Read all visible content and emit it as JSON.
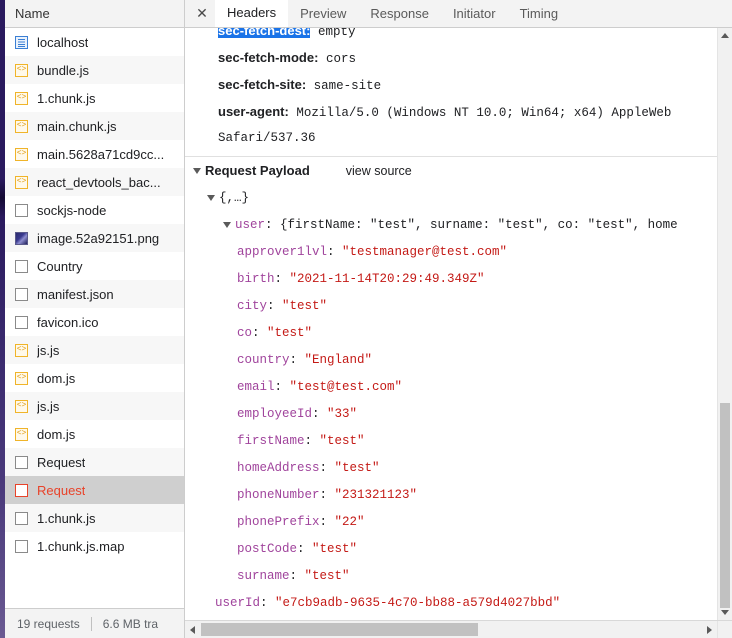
{
  "sidebar": {
    "header": "Name",
    "files": [
      {
        "name": "localhost",
        "icon": "document-icon",
        "kind": "doc",
        "selected": false
      },
      {
        "name": "bundle.js",
        "icon": "js-file-icon",
        "kind": "js",
        "selected": false
      },
      {
        "name": "1.chunk.js",
        "icon": "js-file-icon",
        "kind": "js",
        "selected": false
      },
      {
        "name": "main.chunk.js",
        "icon": "js-file-icon",
        "kind": "js",
        "selected": false
      },
      {
        "name": "main.5628a71cd9cc...",
        "icon": "js-file-icon",
        "kind": "js",
        "selected": false
      },
      {
        "name": "react_devtools_bac...",
        "icon": "js-file-icon",
        "kind": "js",
        "selected": false
      },
      {
        "name": "sockjs-node",
        "icon": "generic-file-icon",
        "kind": "plain",
        "selected": false
      },
      {
        "name": "image.52a92151.png",
        "icon": "image-file-icon",
        "kind": "img",
        "selected": false
      },
      {
        "name": "Country",
        "icon": "generic-file-icon",
        "kind": "plain",
        "selected": false
      },
      {
        "name": "manifest.json",
        "icon": "generic-file-icon",
        "kind": "plain",
        "selected": false
      },
      {
        "name": "favicon.ico",
        "icon": "generic-file-icon",
        "kind": "plain",
        "selected": false
      },
      {
        "name": "js.js",
        "icon": "js-file-icon",
        "kind": "js",
        "selected": false
      },
      {
        "name": "dom.js",
        "icon": "js-file-icon",
        "kind": "js",
        "selected": false
      },
      {
        "name": "js.js",
        "icon": "js-file-icon",
        "kind": "js",
        "selected": false
      },
      {
        "name": "dom.js",
        "icon": "js-file-icon",
        "kind": "js",
        "selected": false
      },
      {
        "name": "Request",
        "icon": "generic-file-icon",
        "kind": "plain",
        "selected": false
      },
      {
        "name": "Request",
        "icon": "error-file-icon",
        "kind": "err",
        "selected": true
      },
      {
        "name": "1.chunk.js",
        "icon": "generic-file-icon",
        "kind": "plain",
        "selected": false
      },
      {
        "name": "1.chunk.js.map",
        "icon": "generic-file-icon",
        "kind": "plain",
        "selected": false
      }
    ],
    "footer": {
      "requests": "19 requests",
      "transferred": "6.6 MB tra"
    }
  },
  "detail": {
    "close_label": "✕",
    "tabs": [
      {
        "label": "Headers",
        "active": true
      },
      {
        "label": "Preview",
        "active": false
      },
      {
        "label": "Response",
        "active": false
      },
      {
        "label": "Initiator",
        "active": false
      },
      {
        "label": "Timing",
        "active": false
      }
    ],
    "headers": [
      {
        "name": "sec-fetch-dest",
        "value": "empty",
        "selected": true,
        "clipped": true
      },
      {
        "name": "sec-fetch-mode",
        "value": "cors",
        "selected": false,
        "clipped": false
      },
      {
        "name": "sec-fetch-site",
        "value": "same-site",
        "selected": false,
        "clipped": false
      },
      {
        "name": "user-agent",
        "value": "Mozilla/5.0 (Windows NT 10.0; Win64; x64) AppleWeb",
        "selected": false,
        "clipped": false
      }
    ],
    "header_continuation": "Safari/537.36",
    "payload": {
      "title": "Request Payload",
      "view_source": "view source",
      "root_label": "{,…}",
      "object_key": "user",
      "object_preview": "{firstName: \"test\", surname: \"test\", co: \"test\", home",
      "fields": [
        {
          "key": "approver1lvl",
          "value": "\"testmanager@test.com\"",
          "indent": 2
        },
        {
          "key": "birth",
          "value": "\"2021-11-14T20:29:49.349Z\"",
          "indent": 2
        },
        {
          "key": "city",
          "value": "\"test\"",
          "indent": 2
        },
        {
          "key": "co",
          "value": "\"test\"",
          "indent": 2
        },
        {
          "key": "country",
          "value": "\"England\"",
          "indent": 2
        },
        {
          "key": "email",
          "value": "\"test@test.com\"",
          "indent": 2
        },
        {
          "key": "employeeId",
          "value": "\"33\"",
          "indent": 2
        },
        {
          "key": "firstName",
          "value": "\"test\"",
          "indent": 2
        },
        {
          "key": "homeAddress",
          "value": "\"test\"",
          "indent": 2
        },
        {
          "key": "phoneNumber",
          "value": "\"231321123\"",
          "indent": 2
        },
        {
          "key": "phonePrefix",
          "value": "\"22\"",
          "indent": 2
        },
        {
          "key": "postCode",
          "value": "\"test\"",
          "indent": 2
        },
        {
          "key": "surname",
          "value": "\"test\"",
          "indent": 2
        },
        {
          "key": "userId",
          "value": "\"e7cb9adb-9635-4c70-bb88-a579d4027bbd\"",
          "indent": 1
        }
      ]
    }
  },
  "colors": {
    "selection_blue": "#1a73e8",
    "error_red": "#e8432a",
    "json_key": "#a0449c",
    "json_string": "#c41a16",
    "js_icon": "#f0b429"
  }
}
